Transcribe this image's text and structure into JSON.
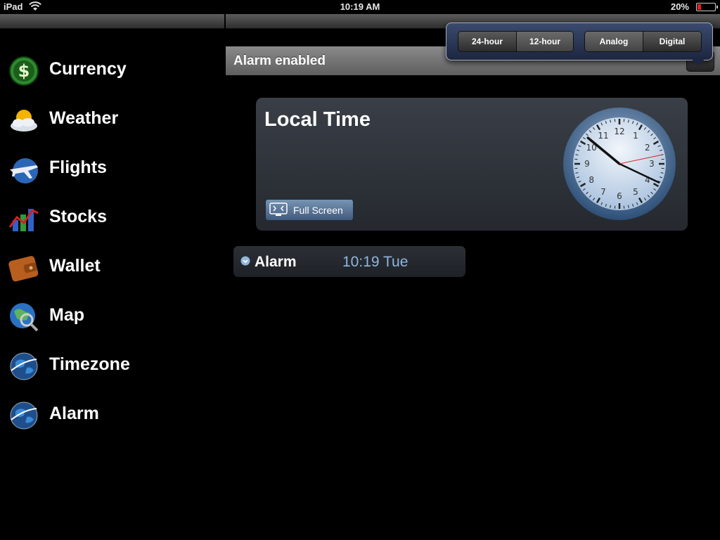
{
  "status_bar": {
    "device": "iPad",
    "time": "10:19 AM",
    "battery": "20%",
    "battery_level": 0.2
  },
  "sidebar": {
    "items": [
      {
        "label": "Currency",
        "icon": "currency-icon"
      },
      {
        "label": "Weather",
        "icon": "weather-icon"
      },
      {
        "label": "Flights",
        "icon": "flights-icon"
      },
      {
        "label": "Stocks",
        "icon": "stocks-icon"
      },
      {
        "label": "Wallet",
        "icon": "wallet-icon"
      },
      {
        "label": "Map",
        "icon": "map-icon"
      },
      {
        "label": "Timezone",
        "icon": "globe-icon"
      },
      {
        "label": "Alarm",
        "icon": "globe-icon"
      }
    ]
  },
  "detail": {
    "title": "Alarm enabled"
  },
  "popover": {
    "hour_format": {
      "options": [
        "24-hour",
        "12-hour"
      ]
    },
    "clock_style": {
      "options": [
        "Analog",
        "Digital"
      ]
    }
  },
  "local_time": {
    "title": "Local Time",
    "fullscreen_label": "Full Screen",
    "clock": {
      "hour": 10,
      "minute": 19,
      "second": 13
    }
  },
  "alarm": {
    "label": "Alarm",
    "time": "10:19 Tue"
  },
  "colors": {
    "accent_text": "#8fb6de",
    "battery_low": "#dd2222"
  }
}
